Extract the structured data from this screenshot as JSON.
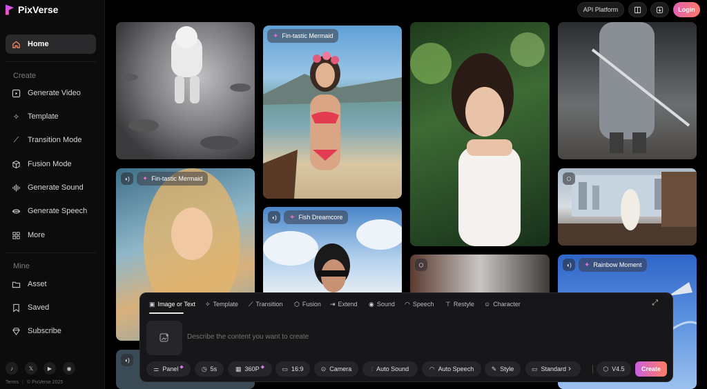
{
  "app": {
    "name": "PixVerse"
  },
  "header": {
    "api_platform": "API Platform",
    "login": "Login"
  },
  "sidebar": {
    "home": "Home",
    "create_section": "Create",
    "create_items": [
      "Generate Video",
      "Template",
      "Transition Mode",
      "Fusion Mode",
      "Generate Sound",
      "Generate Speech",
      "More"
    ],
    "mine_section": "Mine",
    "mine_items": [
      "Asset",
      "Saved",
      "Subscribe"
    ],
    "footer_terms": "Terms",
    "footer_copy": "© PixVerse 2025"
  },
  "gallery": {
    "tags": [
      "Fin-tastic Mermaid",
      "Fin-tastic Mermaid",
      "Fish Dreamcore",
      "Rainbow Moment"
    ]
  },
  "panel": {
    "tabs": [
      "Image or Text",
      "Template",
      "Transition",
      "Fusion",
      "Extend",
      "Sound",
      "Speech",
      "Restyle",
      "Character"
    ],
    "prompt_placeholder": "Describe the content you want to create",
    "chips": [
      "Panel",
      "5s",
      "360P",
      "16:9",
      "Camera",
      "Auto Sound",
      "Auto Speech",
      "Style",
      "Standard"
    ],
    "model": "V4.5",
    "create": "Create"
  },
  "colors": {
    "accent": "#e25fb0",
    "accent2": "#ff7a6a"
  }
}
